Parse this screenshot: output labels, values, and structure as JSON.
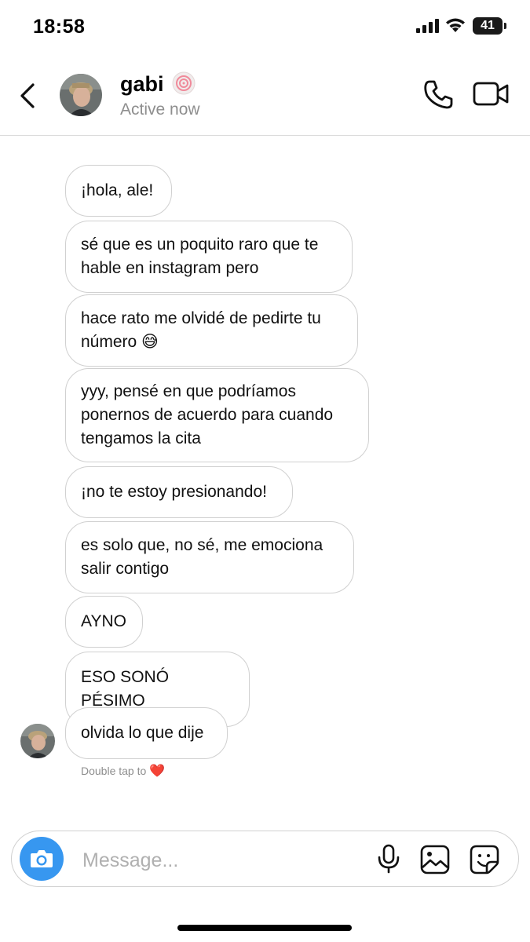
{
  "status_bar": {
    "time": "18:58",
    "battery": "41"
  },
  "header": {
    "name": "gabi",
    "status": "Active now"
  },
  "messages": [
    {
      "lines": [
        "¡hola, ale!"
      ]
    },
    {
      "lines": [
        "sé que es un poquito raro que te",
        "hable en instagram pero"
      ]
    },
    {
      "lines": [
        "hace rato me olvidé de pedirte tu",
        "número 😅"
      ]
    },
    {
      "lines": [
        "yyy, pensé en que podríamos",
        "ponernos de acuerdo para cuando",
        "tengamos la cita"
      ]
    },
    {
      "lines": [
        "¡no te estoy presionando!"
      ]
    },
    {
      "lines": [
        "es solo que, no sé, me emociona",
        "salir contigo"
      ]
    },
    {
      "lines": [
        "AYNO"
      ]
    },
    {
      "lines": [
        "ESO SONÓ PÉSIMO"
      ]
    },
    {
      "lines": [
        "olvida lo que dije"
      ]
    }
  ],
  "hint": {
    "text": "Double tap to",
    "heart": "❤️"
  },
  "composer": {
    "placeholder": "Message..."
  },
  "colors": {
    "accent": "#3797f0",
    "bubble_border": "#d0d0d0",
    "muted": "#8e8e8e"
  },
  "icons": [
    "back-chevron-icon",
    "verified-swirl-icon",
    "phone-icon",
    "video-camera-icon",
    "camera-icon",
    "microphone-icon",
    "gallery-icon",
    "sticker-icon"
  ]
}
